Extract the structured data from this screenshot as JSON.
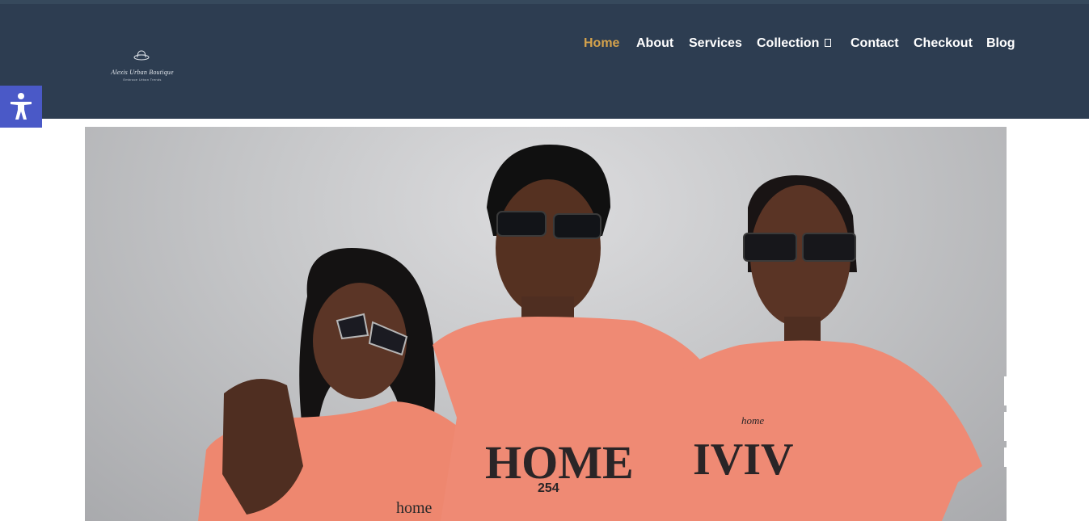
{
  "brand": {
    "name": "Alexis Urban Boutique",
    "tagline": "Embrace Urban Trends",
    "logo_icon": "hat-icon"
  },
  "nav": {
    "items": [
      {
        "label": "Home",
        "active": true
      },
      {
        "label": "About",
        "active": false
      },
      {
        "label": "Services",
        "active": false
      },
      {
        "label": "Collection",
        "active": false,
        "has_dropdown": true
      },
      {
        "label": "Contact",
        "active": false
      },
      {
        "label": "Checkout",
        "active": false
      },
      {
        "label": "Blog",
        "active": false
      }
    ],
    "dropdown_icon": "chevron-down-icon"
  },
  "accessibility": {
    "icon": "accessibility-icon"
  },
  "hero": {
    "image_alt": "Three models in coral t-shirts wearing sunglasses",
    "shirt_prints": [
      "home",
      "HOME",
      "254",
      "home",
      "IVIV"
    ]
  },
  "colors": {
    "header_bg": "#2d3d51",
    "active_link": "#d4a24c",
    "link": "#ffffff",
    "a11y_button": "#4a59c7",
    "shirt": "#ef8a74"
  }
}
